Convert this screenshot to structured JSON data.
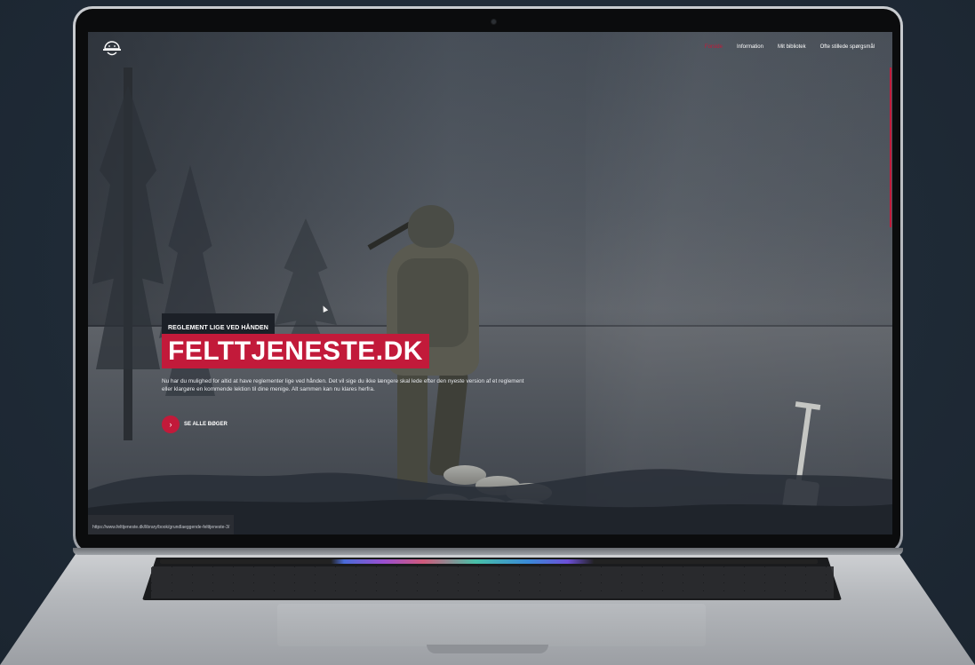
{
  "nav": {
    "items": [
      {
        "label": "Forside",
        "active": true
      },
      {
        "label": "Information",
        "active": false
      },
      {
        "label": "Mit bibliotek",
        "active": false
      },
      {
        "label": "Ofte stillede spørgsmål",
        "active": false
      }
    ]
  },
  "hero": {
    "badge": "REGLEMENT LIGE VED HÅNDEN",
    "title": "FELTTJENESTE.DK",
    "description": "Nu har du mulighed for altid at have reglementer lige ved hånden. Det vil sige du ikke længere skal lede efter den nyeste version af et reglement eller klargøre en kommende lektion til dine menige. Alt sammen kan nu klares herfra.",
    "cta_label": "SE ALLE BØGER",
    "cta_icon": "chevron-right-icon"
  },
  "status_bar": {
    "url": "https://www.felttjeneste.dk/library/book/grundlaeggende-felttjeneste-3/"
  },
  "colors": {
    "accent": "#c21a3a",
    "badge_bg": "#1c2027",
    "background": "#1f2a36"
  }
}
